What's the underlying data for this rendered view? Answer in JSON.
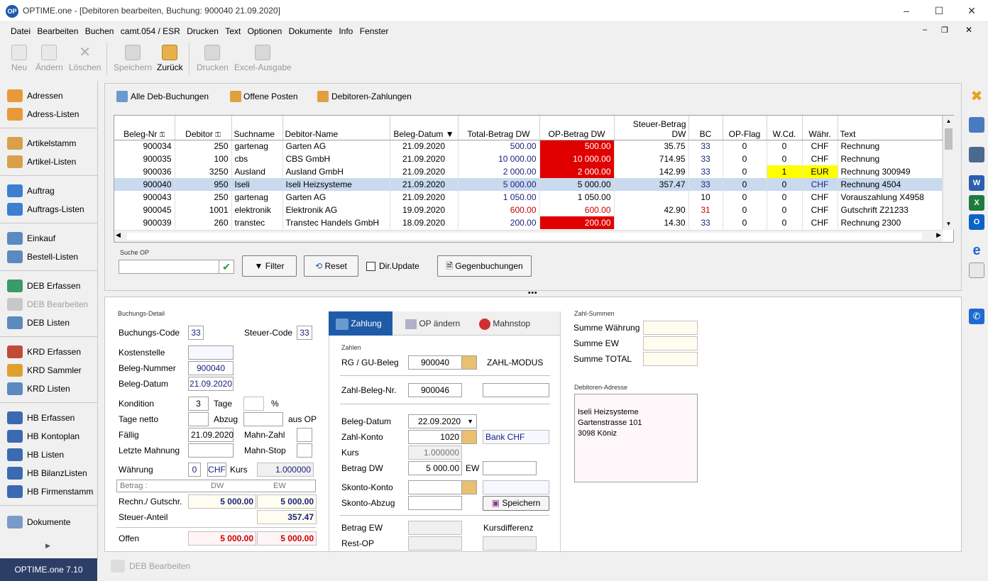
{
  "window": {
    "title": "OPTIME.one - [Debitoren bearbeiten, Buchung: 900040 21.09.2020]",
    "logo": "OP"
  },
  "menu": [
    "Datei",
    "Bearbeiten",
    "Buchen",
    "camt.054 / ESR",
    "Drucken",
    "Text",
    "Optionen",
    "Dokumente",
    "Info",
    "Fenster"
  ],
  "toolbar": {
    "neu": "Neu",
    "aendern": "Ändern",
    "loeschen": "Löschen",
    "speichern": "Speichern",
    "zurueck": "Zurück",
    "drucken": "Drucken",
    "excel": "Excel-Ausgabe"
  },
  "sidebar": {
    "g1": [
      "Adressen",
      "Adress-Listen"
    ],
    "g2": [
      "Artikelstamm",
      "Artikel-Listen"
    ],
    "g3": [
      "Auftrag",
      "Auftrags-Listen"
    ],
    "g4": [
      "Einkauf",
      "Bestell-Listen"
    ],
    "g5": [
      "DEB Erfassen",
      "DEB Bearbeiten",
      "DEB Listen"
    ],
    "g6": [
      "KRD Erfassen",
      "KRD Sammler",
      "KRD Listen"
    ],
    "g7": [
      "HB Erfassen",
      "HB Kontoplan",
      "HB Listen",
      "HB BilanzListen",
      "HB Firmenstamm"
    ],
    "g8": [
      "Dokumente"
    ]
  },
  "status": {
    "version": "OPTIME.one  7.10",
    "bottom_tab": "DEB Bearbeiten"
  },
  "tabs": {
    "alle": "Alle Deb-Buchungen",
    "offene": "Offene Posten",
    "zahlungen": "Debitoren-Zahlungen"
  },
  "grid": {
    "headers": [
      "Beleg-Nr",
      "Debitor",
      "Suchname",
      "Debitor-Name",
      "Beleg-Datum",
      "Total-Betrag DW",
      "OP-Betrag DW",
      "Steuer-Betrag DW",
      "BC",
      "OP-Flag",
      "W.Cd.",
      "Währ.",
      "Text"
    ],
    "rows": [
      [
        "900034",
        "250",
        "gartenag",
        "Garten AG",
        "21.09.2020",
        "500.00",
        "500.00",
        "35.75",
        "33",
        "0",
        "0",
        "CHF",
        "Rechnung"
      ],
      [
        "900035",
        "100",
        "cbs",
        "CBS GmbH",
        "21.09.2020",
        "10 000.00",
        "10 000.00",
        "714.95",
        "33",
        "0",
        "0",
        "CHF",
        "Rechnung"
      ],
      [
        "900036",
        "3250",
        "Ausland",
        "Ausland GmbH",
        "21.09.2020",
        "2 000.00",
        "2 000.00",
        "142.99",
        "33",
        "0",
        "1",
        "EUR",
        "Rechnung 300949"
      ],
      [
        "900040",
        "950",
        "Iseli",
        "Iseli Heizsysteme",
        "21.09.2020",
        "5 000.00",
        "5 000.00",
        "357.47",
        "33",
        "0",
        "0",
        "CHF",
        "Rechnung 4504"
      ],
      [
        "900043",
        "250",
        "gartenag",
        "Garten AG",
        "21.09.2020",
        "1 050.00",
        "1 050.00",
        "",
        "10",
        "0",
        "0",
        "CHF",
        "Vorauszahlung X4958"
      ],
      [
        "900045",
        "1001",
        "elektronik",
        "Elektronik AG",
        "19.09.2020",
        "600.00",
        "600.00",
        "42.90",
        "31",
        "0",
        "0",
        "CHF",
        "Gutschrift Z21233"
      ],
      [
        "900039",
        "260",
        "transtec",
        "Transtec Handels GmbH",
        "18.09.2020",
        "200.00",
        "200.00",
        "14.30",
        "33",
        "0",
        "0",
        "CHF",
        "Rechnung 2300"
      ]
    ]
  },
  "search": {
    "label": "Suche OP",
    "value": "",
    "filter": "Filter",
    "reset": "Reset",
    "dirupdate": "Dir.Update",
    "gegen": "Gegenbuchungen"
  },
  "detail": {
    "title": "Buchungs-Detail",
    "buchungscode_l": "Buchungs-Code",
    "buchungscode": "33",
    "steuercode_l": "Steuer-Code",
    "steuercode": "33",
    "kostenstelle_l": "Kostenstelle",
    "belegnr_l": "Beleg-Nummer",
    "belegnr": "900040",
    "belegdatum_l": "Beleg-Datum",
    "belegdatum": "21.09.2020",
    "kondition_l": "Kondition",
    "kondition": "3",
    "tage_l": "Tage",
    "pct": "%",
    "tagenetto_l": "Tage netto",
    "abzug_l": "Abzug",
    "ausop": "aus OP",
    "faellig_l": "Fällig",
    "faellig": "21.09.2020",
    "mahnzahl_l": "Mahn-Zahl",
    "letzte_l": "Letzte Mahnung",
    "mahnstop_l": "Mahn-Stop",
    "waehrung_l": "Währung",
    "waehrung_code": "0",
    "waehrung": "CHF",
    "kurs_l": "Kurs",
    "kurs": "1.000000",
    "betrag_l": "Betrag   :",
    "dw": "DW",
    "ew": "EW",
    "rechn_l": "Rechn./ Gutschr.",
    "rechn_dw": "5 000.00",
    "rechn_ew": "5 000.00",
    "steuer_l": "Steuer-Anteil",
    "steuer": "357.47",
    "offen_l": "Offen",
    "offen_dw": "5 000.00",
    "offen_ew": "5 000.00"
  },
  "zahlung": {
    "tab1": "Zahlung",
    "tab2": "OP ändern",
    "tab3": "Mahnstop",
    "section": "Zahlen",
    "rg_l": "RG / GU-Beleg",
    "rg": "900040",
    "modus": "ZAHL-MODUS",
    "zbn_l": "Zahl-Beleg-Nr.",
    "zbn": "900046",
    "bd_l": "Beleg-Datum",
    "bd": "22.09.2020",
    "zk_l": "Zahl-Konto",
    "zk": "1020",
    "bank": "Bank CHF",
    "kurs_l": "Kurs",
    "kurs": "1.000000",
    "bdw_l": "Betrag DW",
    "bdw": "5 000.00",
    "ew_l": "EW",
    "sk_l": "Skonto-Konto",
    "sa_l": "Skonto-Abzug",
    "save": "Speichern",
    "bew_l": "Betrag EW",
    "kd_l": "Kursdifferenz",
    "rest_l": "Rest-OP"
  },
  "summen": {
    "title": "Zahl-Summen",
    "w": "Summe Währung",
    "ew": "Summe EW",
    "total": "Summe TOTAL"
  },
  "adresse": {
    "title": "Debitoren-Adresse",
    "l1": "Iseli Heizsysteme",
    "l2": "Gartenstrasse 101",
    "l3": "3098 Köniz"
  },
  "colors": {
    "accent": "#1e5aa8",
    "selrow": "#c9d9ee",
    "red": "#e00000",
    "yellow": "#ffff00",
    "tabactive": "#1e5aa8"
  }
}
